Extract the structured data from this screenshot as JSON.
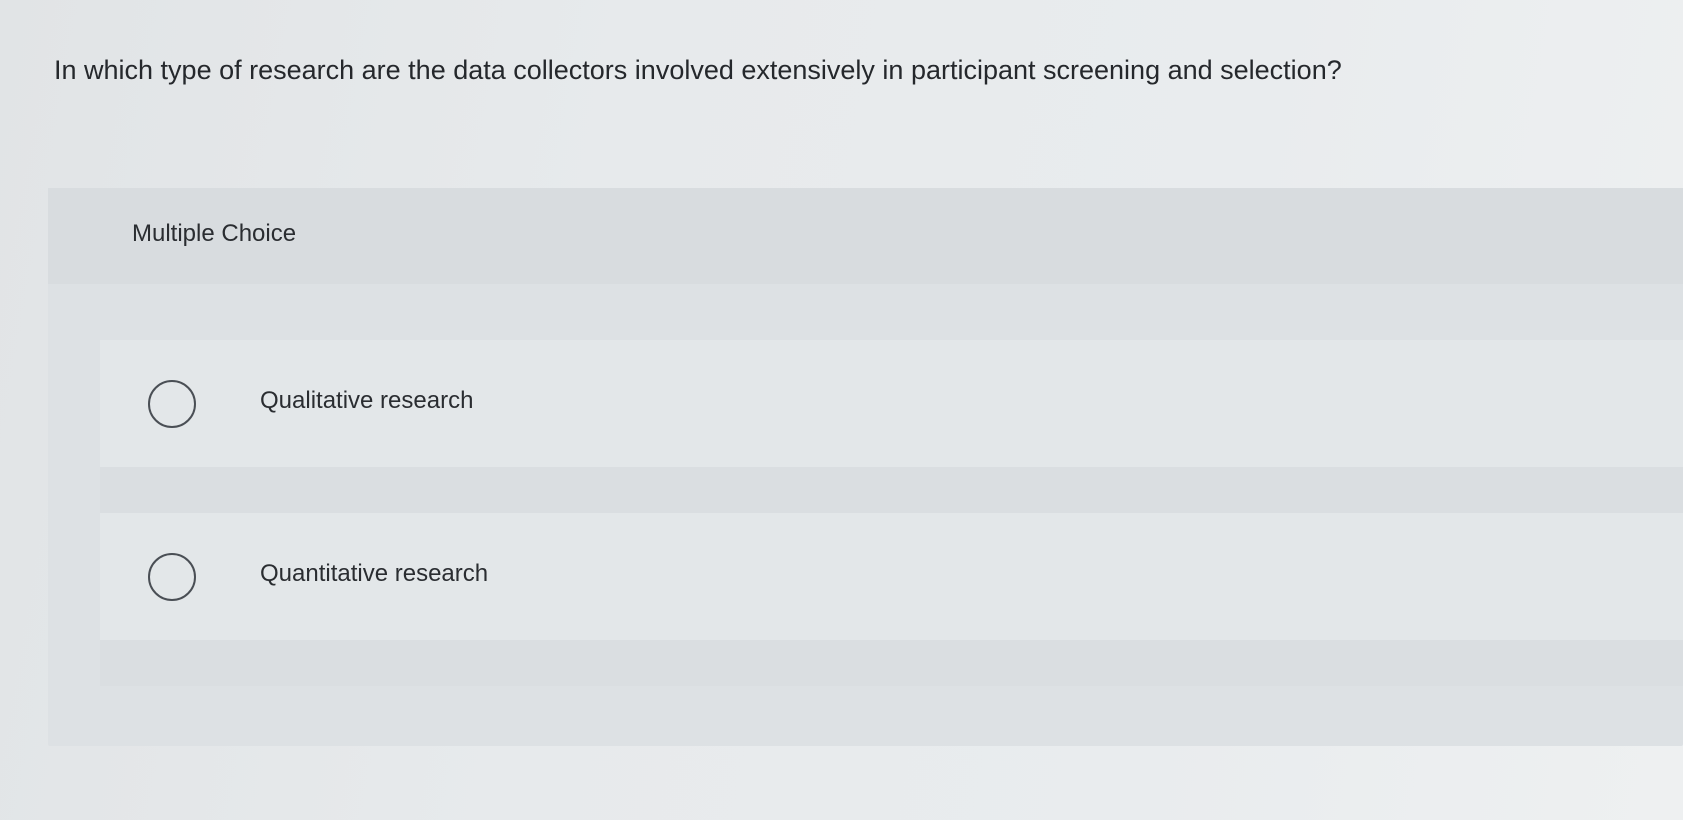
{
  "question": {
    "text": "In which type of research are the data collectors involved extensively in participant screening and selection?"
  },
  "card": {
    "label": "Multiple Choice"
  },
  "options": [
    {
      "label": "Qualitative research",
      "selected": false
    },
    {
      "label": "Quantitative research",
      "selected": false
    }
  ],
  "colors": {
    "background": "#e7eaec",
    "card": "#dde1e4",
    "option": "#e3e7e9",
    "text": "#2a2d31",
    "radio_border": "#4a4f55"
  }
}
